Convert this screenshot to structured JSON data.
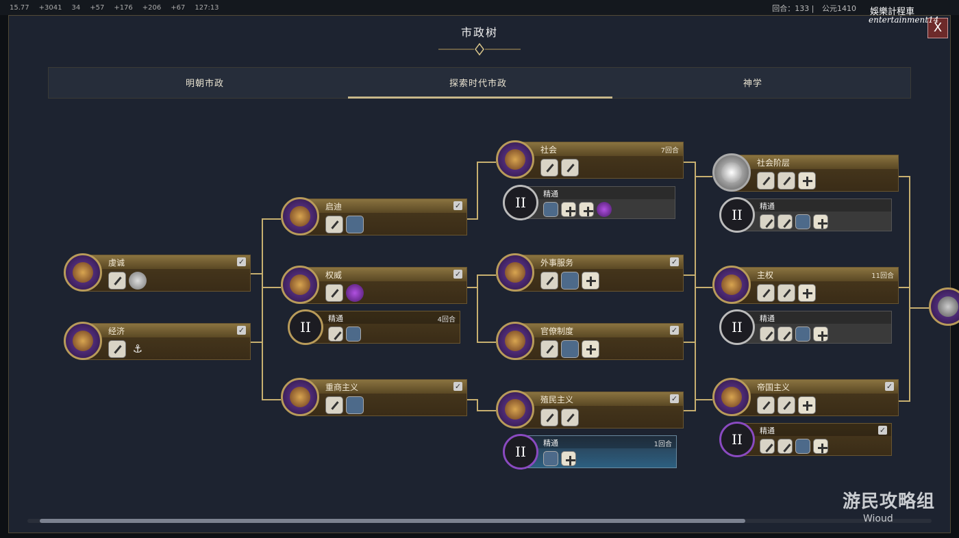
{
  "topbar": {
    "stats": [
      "15.77",
      "+3041",
      "34",
      "+57",
      "+176",
      "+206",
      "+67",
      "127:13"
    ],
    "turn_label": "回合：133",
    "year_label": "公元1410"
  },
  "header": {
    "title": "市政树",
    "close_label": "X"
  },
  "tabs": [
    {
      "label": "明朝市政",
      "active": false
    },
    {
      "label": "探索时代市政",
      "active": true
    },
    {
      "label": "神学",
      "active": false
    }
  ],
  "nodes": {
    "qiancheng": {
      "name": "虔诚",
      "completed": true
    },
    "jingji": {
      "name": "经济",
      "completed": true
    },
    "qidi": {
      "name": "启迪",
      "completed": true
    },
    "quanwei": {
      "name": "权威",
      "completed": true
    },
    "quanwei_mastery": {
      "name": "精通",
      "turns": "4回合"
    },
    "zhongshang": {
      "name": "重商主义",
      "completed": true
    },
    "shehui": {
      "name": "社会",
      "turns": "7回合"
    },
    "shehui_mastery": {
      "name": "精通"
    },
    "waishi": {
      "name": "外事服务",
      "completed": true
    },
    "guanliao": {
      "name": "官僚制度",
      "completed": true
    },
    "zhimin": {
      "name": "殖民主义",
      "completed": true
    },
    "zhimin_mastery": {
      "name": "精通",
      "turns": "1回合"
    },
    "shehuijieceng": {
      "name": "社会阶层"
    },
    "shehuijieceng_mastery": {
      "name": "精通"
    },
    "zhuquan": {
      "name": "主权",
      "turns": "11回合"
    },
    "zhuquan_mastery": {
      "name": "精通"
    },
    "diguo": {
      "name": "帝国主义",
      "completed": true
    },
    "diguo_mastery": {
      "name": "精通",
      "completed": true
    }
  },
  "mastery_numeral": "II",
  "check_glyph": "✓",
  "watermarks": {
    "top_right_cn": "娛樂計程車",
    "top_right_en": "entertainment14",
    "bottom_right_cn": "游民攻略组",
    "bottom_right_en": "Wioud"
  },
  "colors": {
    "panel_bg": "#1d2330",
    "node_gold": "#b89b5a",
    "node_purple": "#6a3da0",
    "active_tab_line": "#c8b88a"
  }
}
